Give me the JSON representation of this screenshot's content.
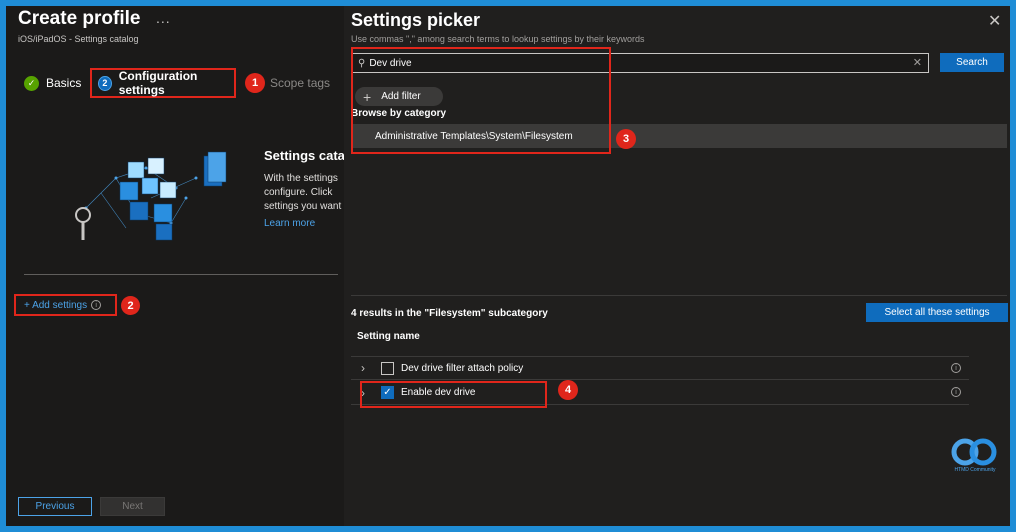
{
  "left": {
    "title": "Create profile",
    "ellipsis": "...",
    "subtitle": "iOS/iPadOS - Settings catalog",
    "steps": [
      {
        "label": "Basics",
        "marker": "✓"
      },
      {
        "label": "Configuration settings",
        "marker": "2"
      },
      {
        "label": "Scope tags"
      }
    ],
    "hero": {
      "title": "Settings catalog",
      "lines": [
        "With the settings",
        "configure. Click",
        "settings you want"
      ],
      "learn_more": "Learn more"
    },
    "add_settings": "+ Add settings",
    "prev": "Previous",
    "next": "Next"
  },
  "picker": {
    "title": "Settings picker",
    "close": "✕",
    "hint": "Use commas \",\" among search terms to lookup settings by their keywords",
    "search_value": "Dev drive",
    "search_button": "Search",
    "add_filter": "Add filter",
    "browse_label": "Browse by category",
    "category": "Administrative Templates\\System\\Filesystem",
    "results_label": "4 results in the \"Filesystem\" subcategory",
    "select_all": "Select all these settings",
    "column": "Setting name",
    "rows": [
      {
        "label": "Dev drive filter attach policy",
        "checked": false
      },
      {
        "label": "Enable dev drive",
        "checked": true
      }
    ]
  },
  "badges": [
    "1",
    "2",
    "3",
    "4"
  ],
  "brand": {
    "logo_text": "HTMD Community"
  },
  "colors": {
    "accent": "#0f6cbd",
    "highlight": "#e0261b",
    "success": "#57a300",
    "link": "#4ca3e8"
  }
}
